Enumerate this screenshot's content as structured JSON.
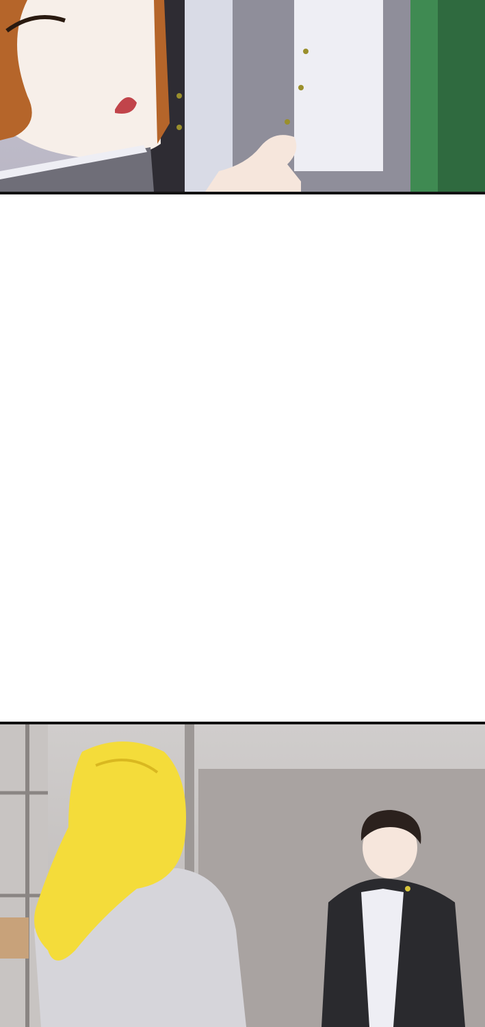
{
  "panels": [
    {
      "id": "panel-top",
      "description_visible_text": ""
    },
    {
      "id": "panel-bottom",
      "description_visible_text": ""
    }
  ],
  "colors": {
    "border": "#111111",
    "gutter": "#ffffff",
    "skin": "#f6e6dc",
    "hair_brown": "#b5652a",
    "hair_blonde": "#f4dc3a",
    "jacket_dark": "#2a2a2e",
    "jacket_grey": "#8f8e9a",
    "shirt_white": "#eeeef4",
    "vest_green": "#3f8a52",
    "wall_concrete": "#a9a3a1"
  }
}
